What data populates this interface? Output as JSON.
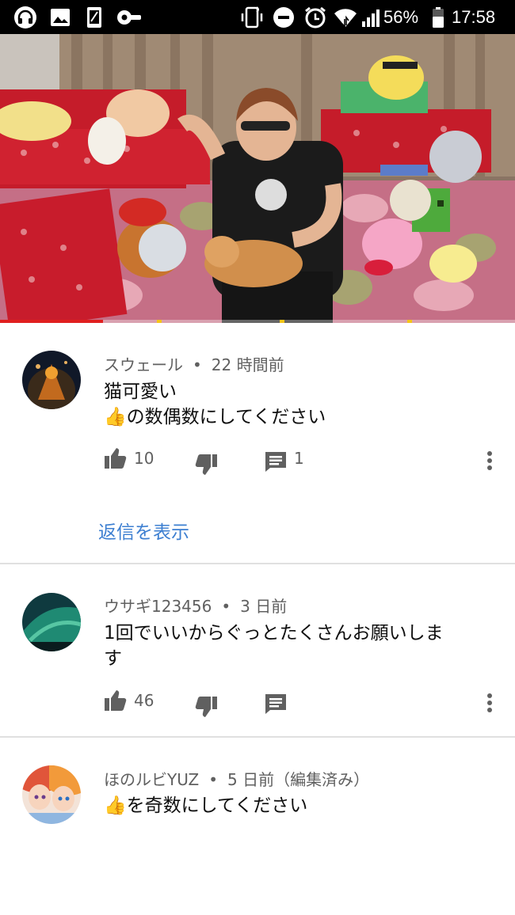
{
  "status_bar": {
    "battery": "56%",
    "time": "17:58",
    "left_icons": [
      "headphones-icon",
      "image-icon",
      "phone-icon",
      "key-icon"
    ],
    "right_icons": [
      "vibrate-icon",
      "do-not-disturb-icon",
      "alarm-icon",
      "wifi-icon",
      "signal-icon",
      "battery-icon"
    ]
  },
  "video": {
    "progress": 0.2,
    "progress_color": "#e01f1f",
    "ad_marker_color": "#f5c518"
  },
  "comments": [
    {
      "author": "スウェール",
      "time": "22 時間前",
      "lines": [
        "猫可愛い",
        "👍の数偶数にしてください"
      ],
      "likes": "10",
      "replies": "1",
      "show_replies": "返信を表示"
    },
    {
      "author": "ウサギ123456",
      "time": "3 日前",
      "lines": [
        "1回でいいからぐっとたくさんお願いしま",
        "す"
      ],
      "likes": "46"
    },
    {
      "author": "ほのルビYUZ",
      "time": "5 日前（編集済み）",
      "lines": [
        "👍を奇数にしてください"
      ]
    }
  ],
  "colors": {
    "link": "#3d7fd1",
    "meta_text": "#606060",
    "divider": "#e0e0e0"
  }
}
